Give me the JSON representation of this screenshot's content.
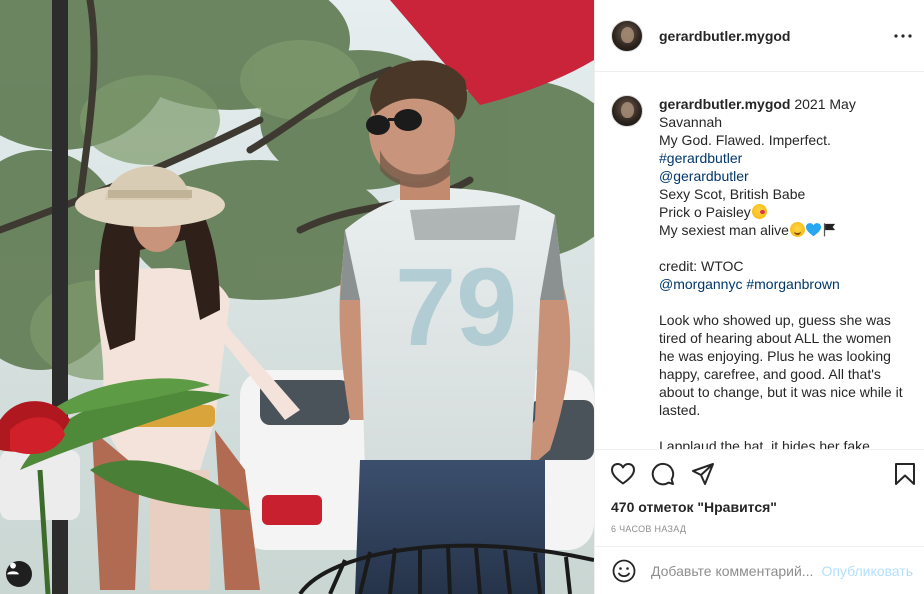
{
  "post": {
    "username": "gerardbutler.mygod",
    "more_icon": "more-horizontal-icon"
  },
  "caption": {
    "username": "gerardbutler.mygod",
    "first_line_rest": " 2021 May",
    "lines": [
      {
        "text": "Savannah"
      },
      {
        "text": "My God. Flawed. Imperfect."
      },
      {
        "text": "#gerardbutler",
        "link": true
      },
      {
        "text": "@gerardbutler",
        "link": true
      },
      {
        "text": "Sexy Scot, British Babe"
      },
      {
        "text": "Prick o Paisley"
      },
      {
        "text": "My sexiest man alive"
      }
    ],
    "credit_label": "credit: WTOC",
    "credit_tags": [
      "@morgannyc",
      "#morganbrown"
    ],
    "paragraph": "Look who showed up, guess she was tired of hearing about ALL the women he was enjoying. Plus he was looking happy, carefree, and good. All that's about to change, but it was nice while it lasted.",
    "cutoff_line": "I applaud the hat, it hides her fake"
  },
  "actions": {
    "like_icon": "heart-icon",
    "comment_icon": "comment-icon",
    "share_icon": "share-icon",
    "save_icon": "bookmark-icon"
  },
  "likes_text": "470 отметок \"Нравится\"",
  "timestamp": "6 часов назад",
  "comment_box": {
    "emoji_icon": "smiley-icon",
    "placeholder": "Добавьте комментарий...",
    "post_label": "Опубликовать"
  },
  "photo": {
    "tag_icon": "user-tag-icon"
  }
}
